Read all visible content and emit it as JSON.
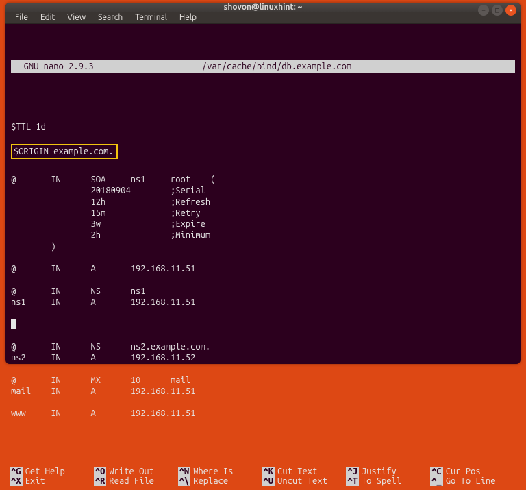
{
  "window": {
    "title": "shovon@linuxhint: ~",
    "btn_min": "−",
    "btn_max": "□",
    "btn_close": "×"
  },
  "menubar": {
    "items": [
      "File",
      "Edit",
      "View",
      "Search",
      "Terminal",
      "Help"
    ]
  },
  "nano": {
    "app_label": "  GNU nano 2.9.3",
    "file_path": "/var/cache/bind/db.example.com"
  },
  "zone_file": {
    "ttl_line": "$TTL 1d",
    "origin_line": "$ORIGIN example.com.",
    "body": "@       IN      SOA     ns1     root    (\n                20180904        ;Serial\n                12h             ;Refresh\n                15m             ;Retry\n                3w              ;Expire\n                2h              ;Minimum\n        )\n\n@       IN      A       192.168.11.51\n\n@       IN      NS      ns1\nns1     IN      A       192.168.11.51\n",
    "cursor_after": "\n@       IN      NS      ns2.example.com.\nns2     IN      A       192.168.11.52\n\n@       IN      MX      10      mail\nmail    IN      A       192.168.11.51\n\nwww     IN      A       192.168.11.51"
  },
  "shortcuts": {
    "c0": {
      "k1": "^G",
      "l1": "Get Help",
      "k2": "^X",
      "l2": "Exit"
    },
    "c1": {
      "k1": "^O",
      "l1": "Write Out",
      "k2": "^R",
      "l2": "Read File"
    },
    "c2": {
      "k1": "^W",
      "l1": "Where Is",
      "k2": "^\\",
      "l2": "Replace"
    },
    "c3": {
      "k1": "^K",
      "l1": "Cut Text",
      "k2": "^U",
      "l2": "Uncut Text"
    },
    "c4": {
      "k1": "^J",
      "l1": "Justify",
      "k2": "^T",
      "l2": "To Spell"
    },
    "c5": {
      "k1": "^C",
      "l1": "Cur Pos",
      "k2": "^_",
      "l2": "Go To Line"
    }
  }
}
